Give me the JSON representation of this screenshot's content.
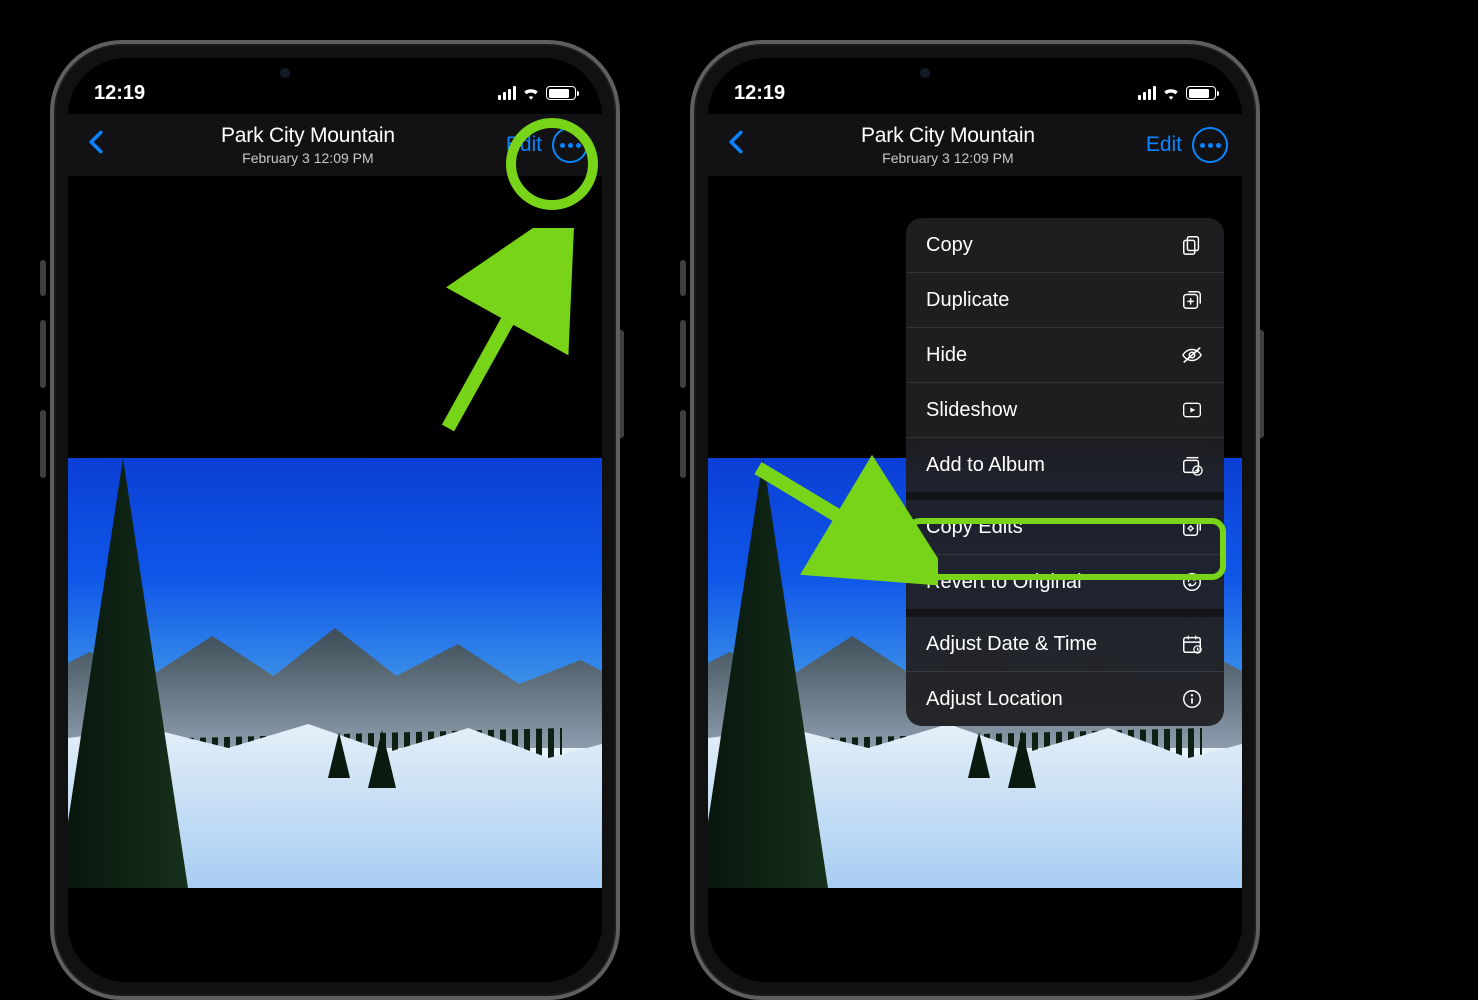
{
  "status": {
    "time": "12:19"
  },
  "header": {
    "title": "Park City Mountain",
    "subtitle": "February 3  12:09 PM",
    "edit_label": "Edit"
  },
  "menu": {
    "items": [
      {
        "label": "Copy",
        "icon": "copy-icon"
      },
      {
        "label": "Duplicate",
        "icon": "duplicate-icon"
      },
      {
        "label": "Hide",
        "icon": "eye-slash-icon"
      },
      {
        "label": "Slideshow",
        "icon": "play-rect-icon"
      },
      {
        "label": "Add to Album",
        "icon": "album-add-icon"
      },
      {
        "label": "Copy Edits",
        "icon": "copy-edits-icon"
      },
      {
        "label": "Revert to Original",
        "icon": "revert-icon"
      },
      {
        "label": "Adjust Date & Time",
        "icon": "calendar-icon"
      },
      {
        "label": "Adjust Location",
        "icon": "info-icon"
      }
    ]
  },
  "annotations": {
    "highlighted_button": "more-button",
    "highlighted_menu_item": "Copy Edits"
  }
}
